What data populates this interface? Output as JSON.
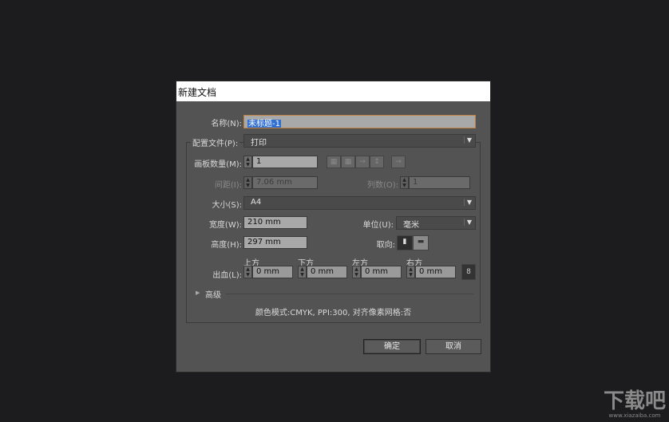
{
  "dialog": {
    "title": "新建文档"
  },
  "name": {
    "label": "名称(N):",
    "value": "未标题-1"
  },
  "profile": {
    "label": "配置文件(P):",
    "value": "打印"
  },
  "artboards": {
    "label": "画板数量(M):",
    "value": "1"
  },
  "spacing": {
    "label": "间距(I):",
    "value": "7.06 mm"
  },
  "columns": {
    "label": "列数(O):",
    "value": "1"
  },
  "size": {
    "label": "大小(S):",
    "value": "A4"
  },
  "width": {
    "label": "宽度(W):",
    "value": "210 mm"
  },
  "units": {
    "label": "单位(U):",
    "value": "毫米"
  },
  "height": {
    "label": "高度(H):",
    "value": "297 mm"
  },
  "orientation": {
    "label": "取向:"
  },
  "bleed": {
    "label": "出血(L):",
    "top_label": "上方",
    "top": "0 mm",
    "bottom_label": "下方",
    "bottom": "0 mm",
    "left_label": "左方",
    "left": "0 mm",
    "right_label": "右方",
    "right": "0 mm"
  },
  "advanced": {
    "label": "高级"
  },
  "summary": "颜色模式:CMYK, PPI:300, 对齐像素网格:否",
  "buttons": {
    "ok": "确定",
    "cancel": "取消"
  },
  "watermark": {
    "text": "下载吧",
    "url": "www.xiazaiba.com"
  }
}
